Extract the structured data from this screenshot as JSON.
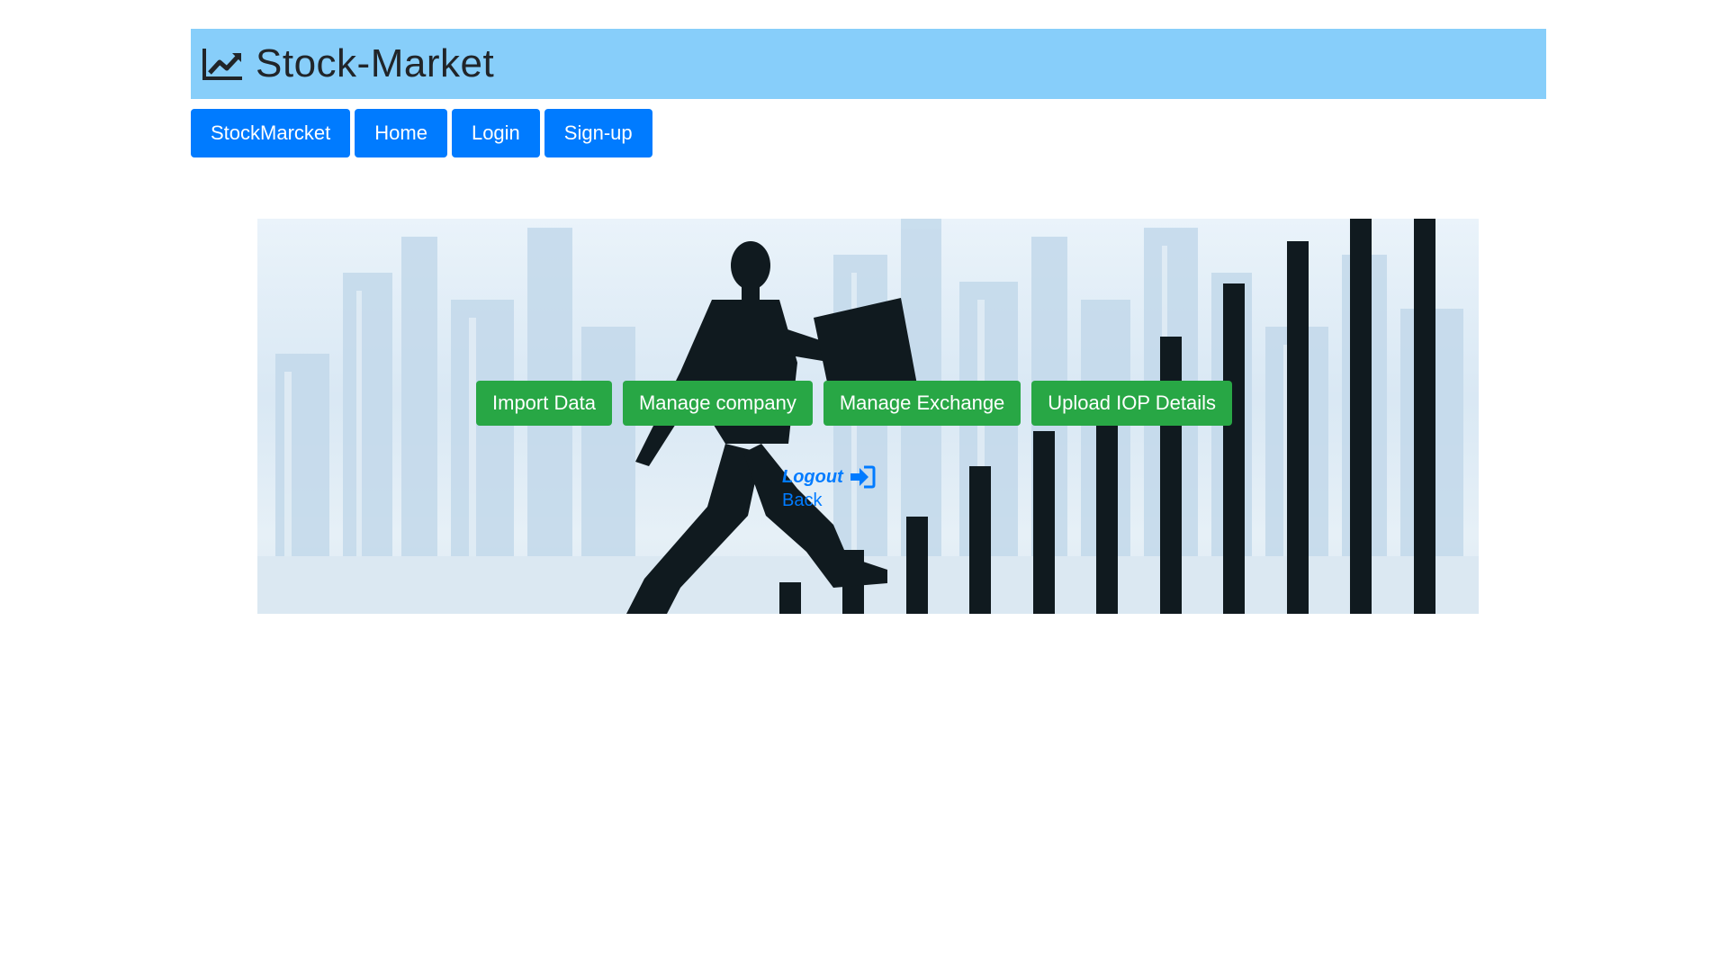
{
  "header": {
    "title": "Stock-Market",
    "icon": "chart-line-icon",
    "bg_color": "#87cefa"
  },
  "nav": {
    "items": [
      {
        "label": "StockMarcket"
      },
      {
        "label": "Home"
      },
      {
        "label": "Login"
      },
      {
        "label": "Sign-up"
      }
    ],
    "color": "#007bff"
  },
  "hero": {
    "image": "businessman-running-up-bar-chart-city-skyline"
  },
  "actions": {
    "import_label": "Import Data",
    "company_label": "Manage company",
    "exchange_label": "Manage Exchange",
    "iop_label": "Upload IOP Details",
    "color": "#28a745"
  },
  "links": {
    "logout_label": "Logout",
    "logout_icon": "sign-in-icon",
    "back_label": "Back"
  }
}
